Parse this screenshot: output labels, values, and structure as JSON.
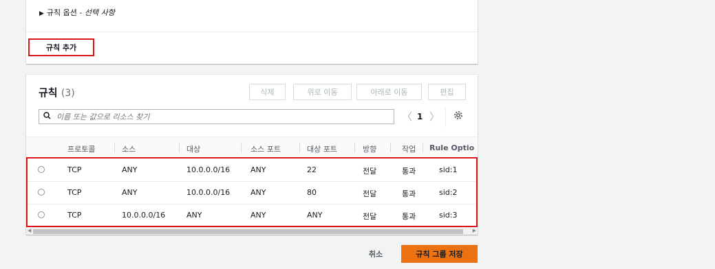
{
  "options_section": {
    "label": "규칙 옵션",
    "separator": " - ",
    "optional": "선택 사항"
  },
  "add_rule_button": "규칙 추가",
  "rules": {
    "title": "규칙",
    "count": "(3)",
    "buttons": {
      "delete": "삭제",
      "move_up": "위로 이동",
      "move_down": "아래로 이동",
      "edit": "편집"
    },
    "search_placeholder": "이름 또는 값으로 리소스 찾기",
    "pagination": {
      "prev": "〈",
      "page": "1",
      "next": "〉"
    },
    "columns": [
      "프로토콜",
      "소스",
      "대상",
      "소스 포트",
      "대상 포트",
      "방향",
      "작업",
      "Rule Optio"
    ],
    "rows": [
      [
        "TCP",
        "ANY",
        "10.0.0.0/16",
        "ANY",
        "22",
        "전달",
        "통과",
        "sid:1"
      ],
      [
        "TCP",
        "ANY",
        "10.0.0.0/16",
        "ANY",
        "80",
        "전달",
        "통과",
        "sid:2"
      ],
      [
        "TCP",
        "10.0.0.0/16",
        "ANY",
        "ANY",
        "ANY",
        "전달",
        "통과",
        "sid:3"
      ]
    ]
  },
  "footer": {
    "cancel": "취소",
    "save": "규칙 그룹 저장"
  },
  "colors": {
    "primary": "#ec7211",
    "highlight": "#d91515"
  }
}
